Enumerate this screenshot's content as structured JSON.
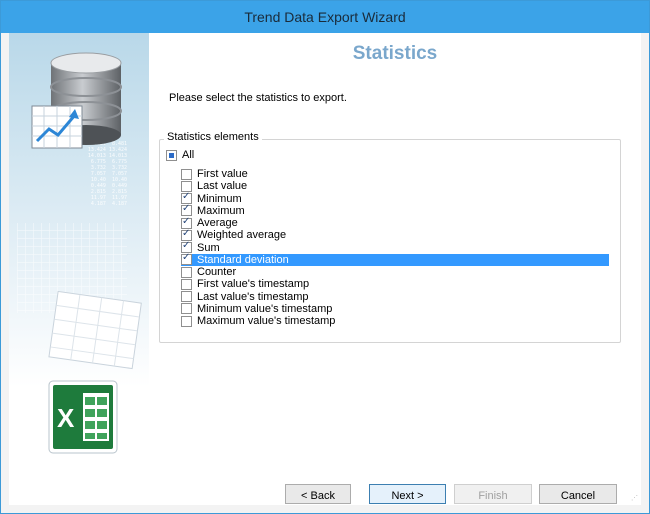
{
  "window": {
    "title": "Trend Data Export Wizard"
  },
  "page": {
    "title": "Statistics",
    "instructions": "Please select the statistics to export."
  },
  "group": {
    "label": "Statistics elements",
    "all_label": "All",
    "items": [
      {
        "label": "First value",
        "checked": false
      },
      {
        "label": "Last value",
        "checked": false
      },
      {
        "label": "Minimum",
        "checked": true
      },
      {
        "label": "Maximum",
        "checked": true
      },
      {
        "label": "Average",
        "checked": true
      },
      {
        "label": "Weighted average",
        "checked": true
      },
      {
        "label": "Sum",
        "checked": true
      },
      {
        "label": "Standard deviation",
        "checked": true,
        "selected": true
      },
      {
        "label": "Counter",
        "checked": false
      },
      {
        "label": "First value's timestamp",
        "checked": false
      },
      {
        "label": "Last value's timestamp",
        "checked": false
      },
      {
        "label": "Minimum value's timestamp",
        "checked": false
      },
      {
        "label": "Maximum value's timestamp",
        "checked": false
      }
    ]
  },
  "buttons": {
    "back": "< Back",
    "next": "Next >",
    "finish": "Finish",
    "cancel": "Cancel"
  },
  "colors": {
    "titlebar": "#3ba3e8",
    "selection": "#3399ff",
    "page_title": "#7aa7cc"
  },
  "icons": [
    "database-icon",
    "chart-arrow-icon",
    "spreadsheet-icon",
    "excel-logo-icon"
  ]
}
